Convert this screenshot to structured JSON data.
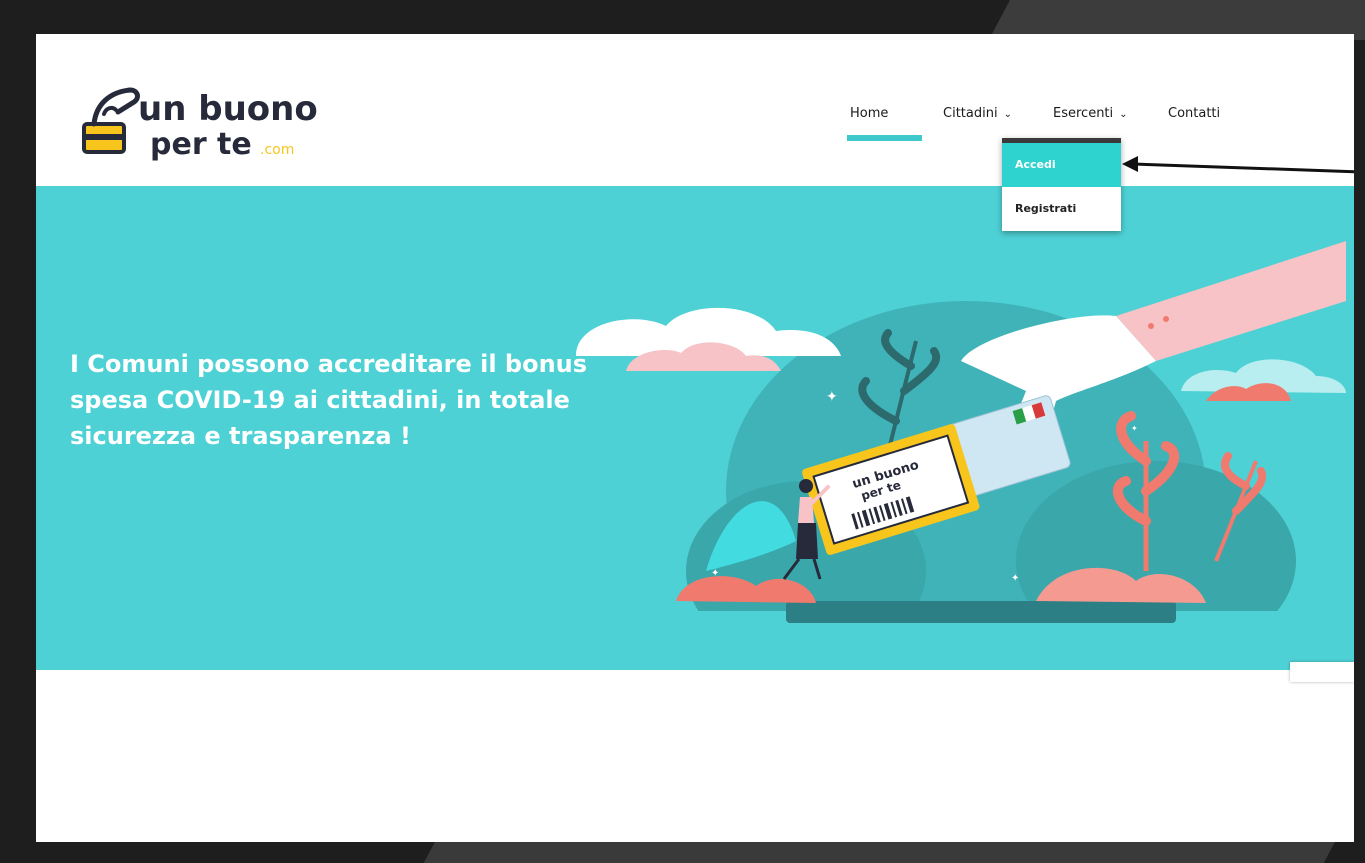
{
  "brand": {
    "logo_line1": "un buono",
    "logo_line2": "per te",
    "logo_suffix": ".com",
    "colors": {
      "dark": "#262a3a",
      "yellow": "#f7c51c"
    }
  },
  "nav": {
    "items": [
      {
        "label": "Home",
        "active": true
      },
      {
        "label": "Cittadini",
        "chevron": "⌄"
      },
      {
        "label": "Esercenti",
        "chevron": "⌄"
      },
      {
        "label": "Contatti"
      }
    ]
  },
  "dropdown": {
    "items": [
      {
        "label": "Accedi",
        "active": true
      },
      {
        "label": "Registrati"
      }
    ]
  },
  "hero": {
    "headline": "I Comuni possono accreditare il bonus spesa COVID-19 ai cittadini, in totale sicurezza e trasparenza !",
    "ticket_line1": "un buono",
    "ticket_line2": "per te"
  },
  "colors": {
    "accent": "#2ed3cf",
    "hero_bg": "#4ed1d5",
    "active_bar": "#3fc9cc",
    "coral": "#f07a6e",
    "pink": "#f7c3c6"
  }
}
